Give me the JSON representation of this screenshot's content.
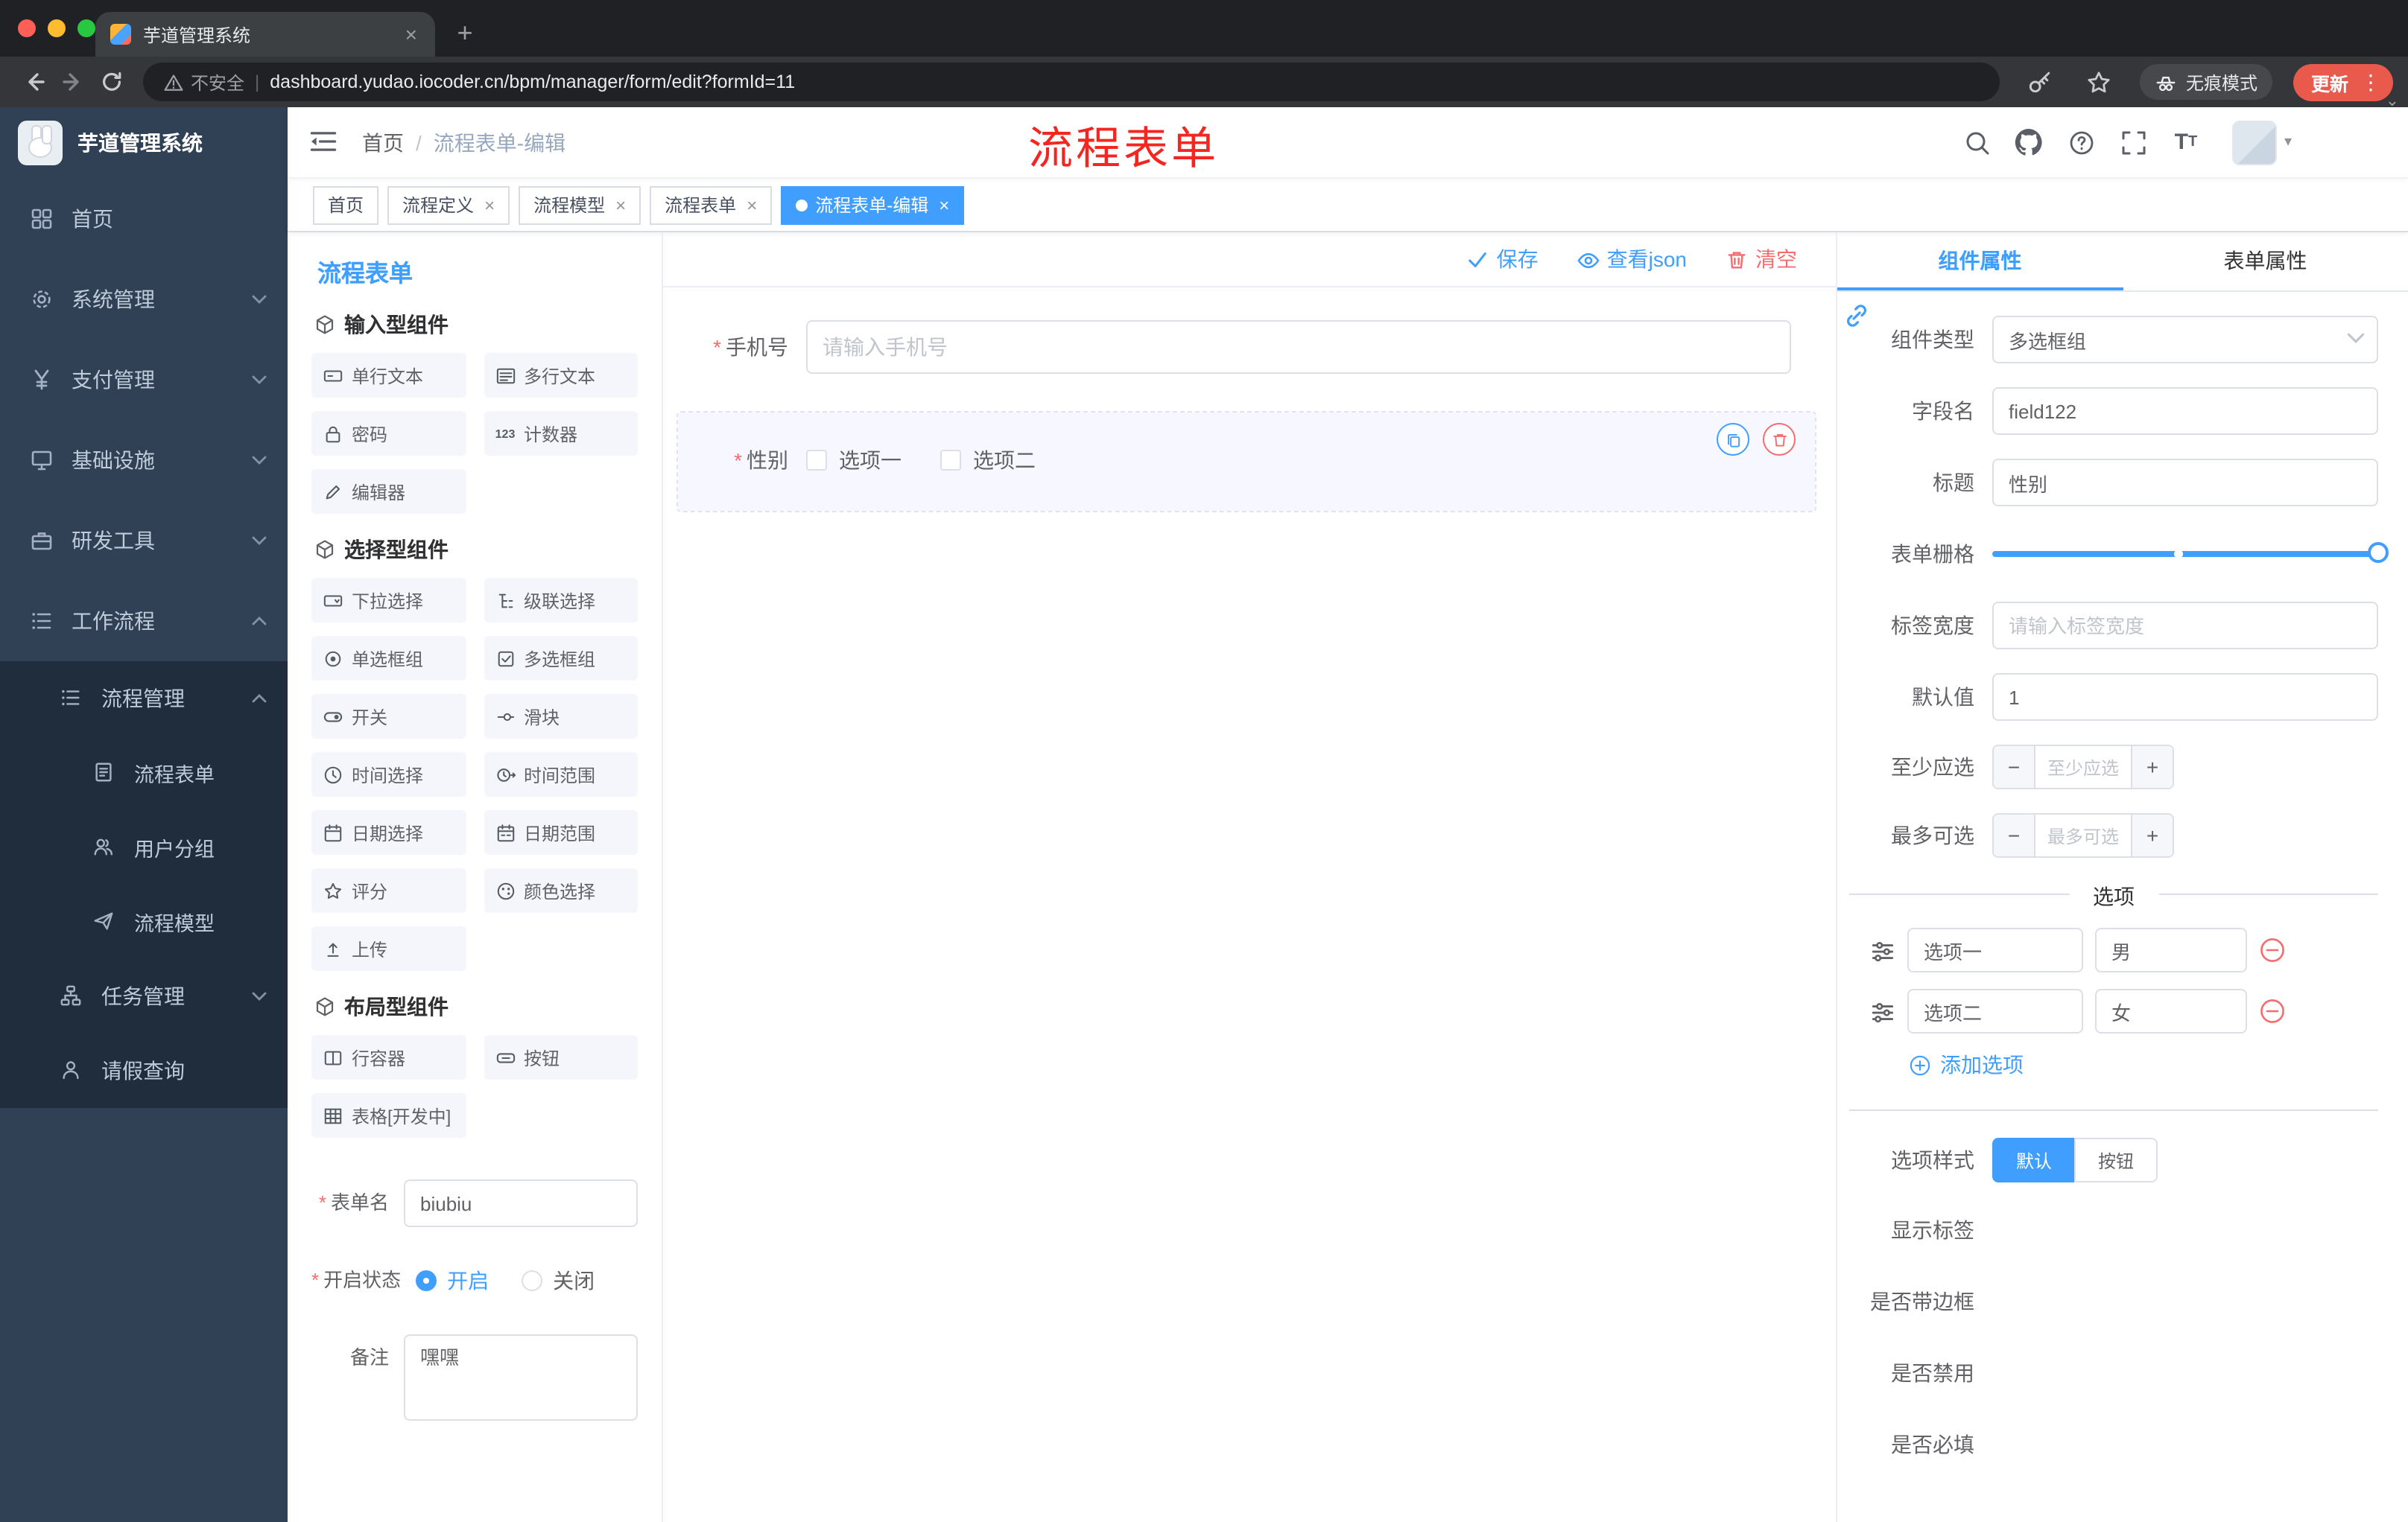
{
  "browser": {
    "tab_title": "芋道管理系统",
    "security_label": "不安全",
    "url": "dashboard.yudao.iocoder.cn/bpm/manager/form/edit?formId=11",
    "incognito_label": "无痕模式",
    "update_label": "更新"
  },
  "sidebar": {
    "logo_title": "芋道管理系统",
    "items": [
      {
        "label": "首页",
        "icon": "dashboard-icon"
      },
      {
        "label": "系统管理",
        "icon": "gear-icon"
      },
      {
        "label": "支付管理",
        "icon": "yen-icon"
      },
      {
        "label": "基础设施",
        "icon": "monitor-icon"
      },
      {
        "label": "研发工具",
        "icon": "briefcase-icon"
      },
      {
        "label": "工作流程",
        "icon": "list-icon"
      },
      {
        "label": "流程管理",
        "icon": "list-icon"
      },
      {
        "label": "流程表单",
        "icon": "document-icon"
      },
      {
        "label": "用户分组",
        "icon": "users-icon"
      },
      {
        "label": "流程模型",
        "icon": "send-icon"
      },
      {
        "label": "任务管理",
        "icon": "tree-icon"
      },
      {
        "label": "请假查询",
        "icon": "user-icon"
      }
    ]
  },
  "navbar": {
    "breadcrumb": {
      "home": "首页",
      "separator": "/",
      "current": "流程表单-编辑"
    },
    "annotation": "流程表单"
  },
  "tags": [
    {
      "label": "首页"
    },
    {
      "label": "流程定义"
    },
    {
      "label": "流程模型"
    },
    {
      "label": "流程表单"
    },
    {
      "label": "流程表单-编辑"
    }
  ],
  "designer": {
    "panel_title": "流程表单",
    "groups": [
      {
        "title": "输入型组件",
        "items": [
          {
            "label": "单行文本",
            "icon": "single-line-input-icon"
          },
          {
            "label": "多行文本",
            "icon": "textarea-icon"
          },
          {
            "label": "密码",
            "icon": "lock-icon"
          },
          {
            "label": "计数器",
            "icon": "counter-icon"
          },
          {
            "label": "编辑器",
            "icon": "editor-icon"
          }
        ]
      },
      {
        "title": "选择型组件",
        "items": [
          {
            "label": "下拉选择",
            "icon": "select-icon"
          },
          {
            "label": "级联选择",
            "icon": "cascader-icon"
          },
          {
            "label": "单选框组",
            "icon": "radio-icon"
          },
          {
            "label": "多选框组",
            "icon": "checkbox-icon"
          },
          {
            "label": "开关",
            "icon": "switch-icon"
          },
          {
            "label": "滑块",
            "icon": "slider-icon"
          },
          {
            "label": "时间选择",
            "icon": "time-icon"
          },
          {
            "label": "时间范围",
            "icon": "time-range-icon"
          },
          {
            "label": "日期选择",
            "icon": "date-icon"
          },
          {
            "label": "日期范围",
            "icon": "date-range-icon"
          },
          {
            "label": "评分",
            "icon": "star-icon"
          },
          {
            "label": "颜色选择",
            "icon": "color-icon"
          },
          {
            "label": "上传",
            "icon": "upload-icon"
          }
        ]
      },
      {
        "title": "布局型组件",
        "items": [
          {
            "label": "行容器",
            "icon": "row-icon"
          },
          {
            "label": "按钮",
            "icon": "button-icon"
          },
          {
            "label": "表格[开发中]",
            "icon": "table-icon"
          }
        ]
      }
    ],
    "config": {
      "name_label": "表单名",
      "name_value": "biubiu",
      "status_label": "开启状态",
      "status_on": "开启",
      "status_off": "关闭",
      "remark_label": "备注",
      "remark_value": "嘿嘿"
    }
  },
  "canvas": {
    "toolbar": {
      "save": "保存",
      "view_json": "查看json",
      "clear": "清空"
    },
    "phone": {
      "label": "手机号",
      "placeholder": "请输入手机号"
    },
    "gender": {
      "label": "性别",
      "option1": "选项一",
      "option2": "选项二"
    }
  },
  "props": {
    "tab_component": "组件属性",
    "tab_form": "表单属性",
    "type_label": "组件类型",
    "type_value": "多选框组",
    "field_label": "字段名",
    "field_value": "field122",
    "title_label": "标题",
    "title_value": "性别",
    "grid_label": "表单栅格",
    "label_width_label": "标签宽度",
    "label_width_placeholder": "请输入标签宽度",
    "default_label": "默认值",
    "default_value": "1",
    "min_label": "至少应选",
    "min_placeholder": "至少应选",
    "max_label": "最多可选",
    "max_placeholder": "最多可选",
    "options_title": "选项",
    "options": [
      {
        "label": "选项一",
        "value": "男"
      },
      {
        "label": "选项二",
        "value": "女"
      }
    ],
    "add_option": "添加选项",
    "style_label": "选项样式",
    "style_default": "默认",
    "style_button": "按钮",
    "switch_show_label": "显示标签",
    "switch_border": "是否带边框",
    "switch_disabled": "是否禁用",
    "switch_required": "是否必填"
  },
  "colors": {
    "accent": "#409eff",
    "danger": "#f56c6c",
    "sidebar_bg": "#304156",
    "submenu_bg": "#1f2d3d",
    "annotation_red": "#f5261f",
    "chrome_dark": "#202124"
  }
}
